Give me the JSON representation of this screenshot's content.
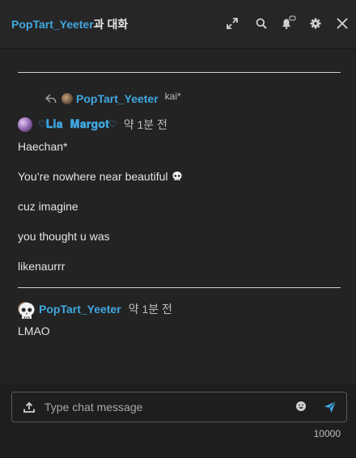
{
  "header": {
    "username": "PopTart_Yeeter",
    "title_suffix": "과 대화",
    "icons": [
      "expand-icon",
      "search-icon",
      "notification-bell-icon",
      "settings-gear-icon",
      "close-icon"
    ]
  },
  "reply_preview": {
    "name": "PopTart_Yeeter",
    "snippet": "kai*"
  },
  "messages": [
    {
      "author": "♡𝐋𝐢𝐚 𝐌𝐚𝐫𝐠𝐨𝐭♡",
      "time": "약 1분 전",
      "lines": [
        "Haechan*",
        "You’re nowhere near beautiful",
        "cuz imagine",
        "you thought u was",
        "likenaurrr"
      ]
    },
    {
      "author": "PopTart_Yeeter",
      "time": "약 1분 전",
      "lines": [
        "LMAO"
      ]
    }
  ],
  "composer": {
    "placeholder": "Type chat message",
    "char_limit": "10000"
  },
  "colors": {
    "accent": "#3fa7e0",
    "send": "#3fa7e0",
    "background": "#1e1e1e"
  }
}
